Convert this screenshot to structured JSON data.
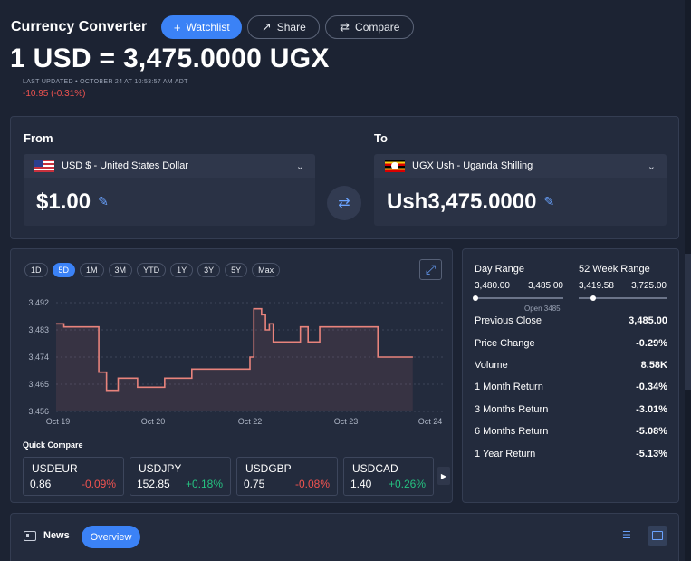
{
  "header": {
    "title": "Currency Converter",
    "watchlist_label": "Watchlist",
    "share_label": "Share",
    "compare_label": "Compare"
  },
  "rate": {
    "headline": "1 USD = 3,475.0000 UGX",
    "last_updated": "LAST UPDATED • OCTOBER 24 AT 10:53:57 AM ADT",
    "change": "-10.95 (-0.31%)"
  },
  "converter": {
    "from_label": "From",
    "to_label": "To",
    "from_currency": "USD $ - United States Dollar",
    "to_currency": "UGX Ush - Uganda Shilling",
    "from_amount": "$1.00",
    "to_amount": "Ush3,475.0000"
  },
  "ranges": [
    "1D",
    "5D",
    "1M",
    "3M",
    "YTD",
    "1Y",
    "3Y",
    "5Y",
    "Max"
  ],
  "active_range": "5D",
  "chart_data": {
    "type": "line",
    "ylim": [
      3456,
      3492
    ],
    "y_ticks": [
      "3,492",
      "3,483",
      "3,474",
      "3,465",
      "3,456"
    ],
    "x_ticks": [
      "Oct 19",
      "Oct 20",
      "Oct 22",
      "Oct 23",
      "Oct 24"
    ],
    "x": [
      0,
      0.02,
      0.1,
      0.11,
      0.13,
      0.15,
      0.16,
      0.2,
      0.21,
      0.28,
      0.29,
      0.35,
      0.36,
      0.5,
      0.51,
      0.53,
      0.54,
      0.55,
      0.56,
      0.57,
      0.61,
      0.63,
      0.65,
      0.66,
      0.68,
      0.69,
      0.81,
      0.83,
      0.92
    ],
    "values": [
      3485,
      3484,
      3484,
      3469,
      3463,
      3463,
      3467,
      3467,
      3464,
      3467,
      3467,
      3470,
      3470,
      3474,
      3490,
      3488,
      3483,
      3485,
      3479,
      3479,
      3479,
      3484,
      3479,
      3479,
      3484,
      3484,
      3484,
      3474,
      3474
    ],
    "line_color": "#e8837c"
  },
  "quick_compare": {
    "title": "Quick Compare",
    "items": [
      {
        "symbol": "USDEUR",
        "value": "0.86",
        "change": "-0.09%",
        "dir": "neg"
      },
      {
        "symbol": "USDJPY",
        "value": "152.85",
        "change": "+0.18%",
        "dir": "pos"
      },
      {
        "symbol": "USDGBP",
        "value": "0.75",
        "change": "-0.08%",
        "dir": "neg"
      },
      {
        "symbol": "USDCAD",
        "value": "1.40",
        "change": "+0.26%",
        "dir": "pos"
      }
    ]
  },
  "stats": {
    "day_range_label": "Day Range",
    "day_low": "3,480.00",
    "day_high": "3,485.00",
    "week52_label": "52 Week Range",
    "week52_low": "3,419.58",
    "week52_high": "3,725.00",
    "open_label": "Open 3485",
    "rows": [
      {
        "label": "Previous Close",
        "value": "3,485.00"
      },
      {
        "label": "Price Change",
        "value": "-0.29%"
      },
      {
        "label": "Volume",
        "value": "8.58K"
      },
      {
        "label": "1 Month Return",
        "value": "-0.34%"
      },
      {
        "label": "3 Months Return",
        "value": "-3.01%"
      },
      {
        "label": "6 Months Return",
        "value": "-5.08%"
      },
      {
        "label": "1 Year Return",
        "value": "-5.13%"
      }
    ]
  },
  "news": {
    "label": "News",
    "overview_label": "Overview"
  },
  "colors": {
    "accent": "#3b82f6",
    "negative": "#ef5350",
    "positive": "#26c281"
  }
}
